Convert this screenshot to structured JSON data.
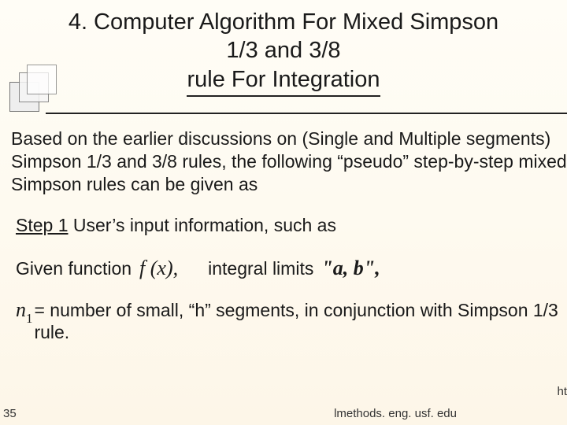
{
  "title": {
    "line1": "4. Computer Algorithm For Mixed Simpson",
    "line2": "1/3 and 3/8",
    "line3": "rule For Integration"
  },
  "body": {
    "para1": "Based on the earlier discussions on (Single and Multiple segments) Simpson 1/3 and 3/8 rules, the following “pseudo” step-by-step mixed Simpson rules can be given as",
    "step_label": "Step 1",
    "step_text": " User’s input information, such as",
    "given_label": "Given function",
    "fx": "f (x),",
    "integral_label": "integral limits",
    "ab": "\"a, b\",",
    "n1_math": "n",
    "n1_sub": "1",
    "n1_text": "= number of small, “h” segments, in conjunction with Simpson 1/3 rule."
  },
  "footer": {
    "slide_no": "35",
    "link": "lmethods. eng. usf. edu",
    "ht": "ht"
  }
}
